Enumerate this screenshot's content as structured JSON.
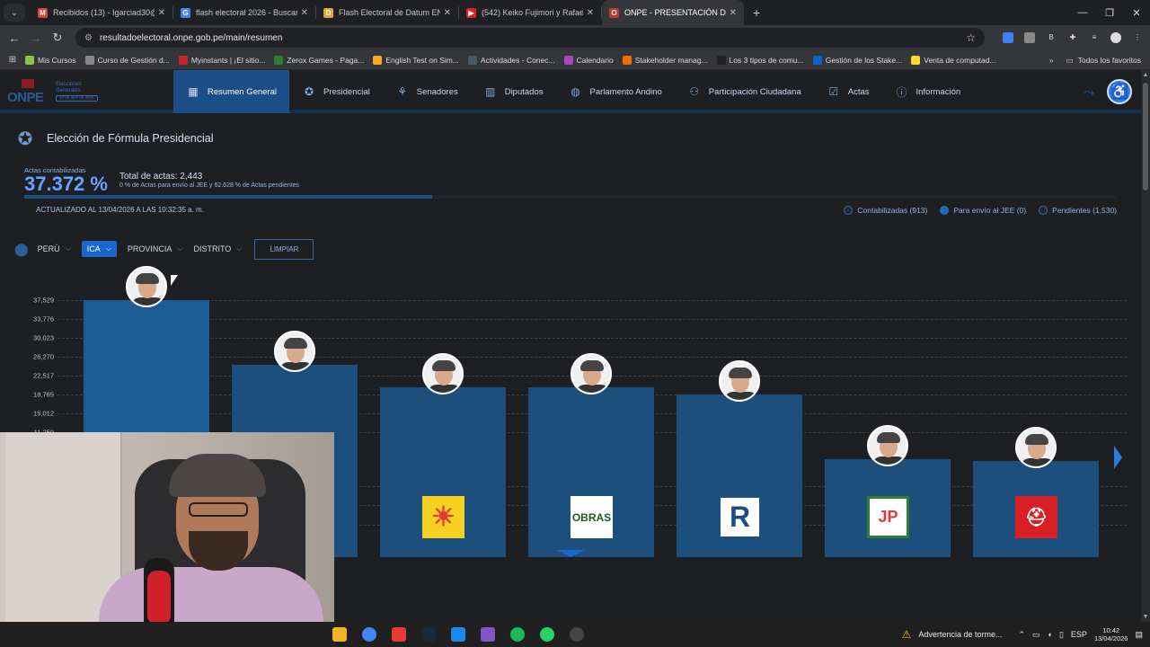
{
  "browser": {
    "tabs": [
      {
        "title": "Recibidos (13) - Igarciad30@gm",
        "color": "#d44638",
        "glyph": "M"
      },
      {
        "title": "flash electoral 2026 - Buscar co",
        "color": "#4285f4",
        "glyph": "G"
      },
      {
        "title": "Flash Electoral de Datum EN VI",
        "color": "#e8a33c",
        "glyph": "D"
      },
      {
        "title": "(542) Keiko Fujimori y Rafael Ló",
        "color": "#e02020",
        "glyph": "▶"
      },
      {
        "title": "ONPE - PRESENTACIÓN DE RES",
        "color": "#c0392b",
        "glyph": "O",
        "active": true
      }
    ],
    "url": "resultadoelectoral.onpe.gob.pe/main/resumen",
    "bookmarks": [
      {
        "label": "Mis Cursos",
        "color": "#8bc34a"
      },
      {
        "label": "Curso de Gestión d...",
        "color": "#888"
      },
      {
        "label": "Myinstants | ¡El sitio...",
        "color": "#c62828"
      },
      {
        "label": "Zerox Games - Paga...",
        "color": "#2e7d32"
      },
      {
        "label": "English Test on Sim...",
        "color": "#f9a825"
      },
      {
        "label": "Actividades - Conec...",
        "color": "#455a64"
      },
      {
        "label": "Calendario",
        "color": "#ab47bc"
      },
      {
        "label": "Stakeholder manag...",
        "color": "#ef6c00"
      },
      {
        "label": "Los 3 tipos de comu...",
        "color": "#212121"
      },
      {
        "label": "Gestión de los Stake...",
        "color": "#0a66c2"
      },
      {
        "label": "Venta de computad...",
        "color": "#fdd835"
      }
    ],
    "all_favorites": "Todos los favoritos"
  },
  "site": {
    "logo": {
      "name": "ONPE",
      "line1": "Elecciones",
      "line2": "Generales",
      "date": "12 de abril de 2026"
    },
    "nav": [
      {
        "label": "Resumen General",
        "icon": "grid-icon",
        "glyph": "▦",
        "active": true
      },
      {
        "label": "Presidencial",
        "icon": "emblem-icon",
        "glyph": "✪"
      },
      {
        "label": "Senadores",
        "icon": "senate-icon",
        "glyph": "⚘"
      },
      {
        "label": "Diputados",
        "icon": "congress-icon",
        "glyph": "▥"
      },
      {
        "label": "Parlamento Andino",
        "icon": "globe-icon",
        "glyph": "◍"
      },
      {
        "label": "Participación Ciudadana",
        "icon": "people-icon",
        "glyph": "⚇"
      },
      {
        "label": "Actas",
        "icon": "check-doc-icon",
        "glyph": "☑"
      },
      {
        "label": "Información",
        "icon": "info-icon",
        "glyph": "ⓘ"
      }
    ],
    "section_title": "Elección de Fórmula Presidencial",
    "actas_label": "Actas contabilizadas",
    "actas_pct": "37.372 %",
    "progress": 0.37372,
    "total_actas": "Total de actas: 2,443",
    "total_detail": "0 % de Actas para envío al JEE y 62.628 % de Actas pendientes",
    "updated": "ACTUALIZADO AL 13/04/2026 A LAS 10:32:35 a. m.",
    "legend": [
      {
        "label": "Contabilizadas (913)",
        "color": "#1e2a3a"
      },
      {
        "label": "Para envío al JEE (0)",
        "color": "#1b66c9"
      },
      {
        "label": "Pendientes (1,530)",
        "color": "#23272d"
      }
    ],
    "filters": {
      "pais": "PERÚ",
      "departamento": "ICA",
      "provincia": "PROVINCIA",
      "distrito": "DISTRITO",
      "limpiar": "LIMPIAR"
    }
  },
  "chart_data": {
    "type": "bar",
    "title": "",
    "ylabel": "",
    "yticks": [
      37529,
      33776,
      30023,
      26270,
      22517,
      18765,
      15012,
      11259
    ],
    "ytick_labels": [
      "37,529",
      "33,776",
      "30,023",
      "26,270",
      "22,517",
      "18,765",
      "15,012",
      "11,259"
    ],
    "ylim": [
      0,
      37529
    ],
    "series": [
      {
        "values": [
          37529,
          28100,
          24800,
          24800,
          23800,
          14300,
          14100
        ],
        "party_logos": [
          "fujimori-avatar",
          "lopez-aliaga-avatar",
          "candidate-3-avatar",
          "candidate-4-avatar",
          "candidate-5-avatar",
          "candidate-6-avatar",
          "candidate-7-avatar"
        ]
      }
    ],
    "parties": [
      {
        "logo": "",
        "color": ""
      },
      {
        "logo": "",
        "color": ""
      },
      {
        "logo": "sun-logo",
        "color": "#f6d11f"
      },
      {
        "logo": "OBRAS",
        "color": "#ffffff"
      },
      {
        "logo": "R",
        "color": "#ffffff"
      },
      {
        "logo": "JP",
        "color": "#ffffff"
      },
      {
        "logo": "helmet-logo",
        "color": "#d81f26"
      }
    ]
  },
  "taskbar": {
    "weather": "Advertencia de torme...",
    "lang": "ESP",
    "time": "10:42",
    "date": "13/04/2026"
  }
}
